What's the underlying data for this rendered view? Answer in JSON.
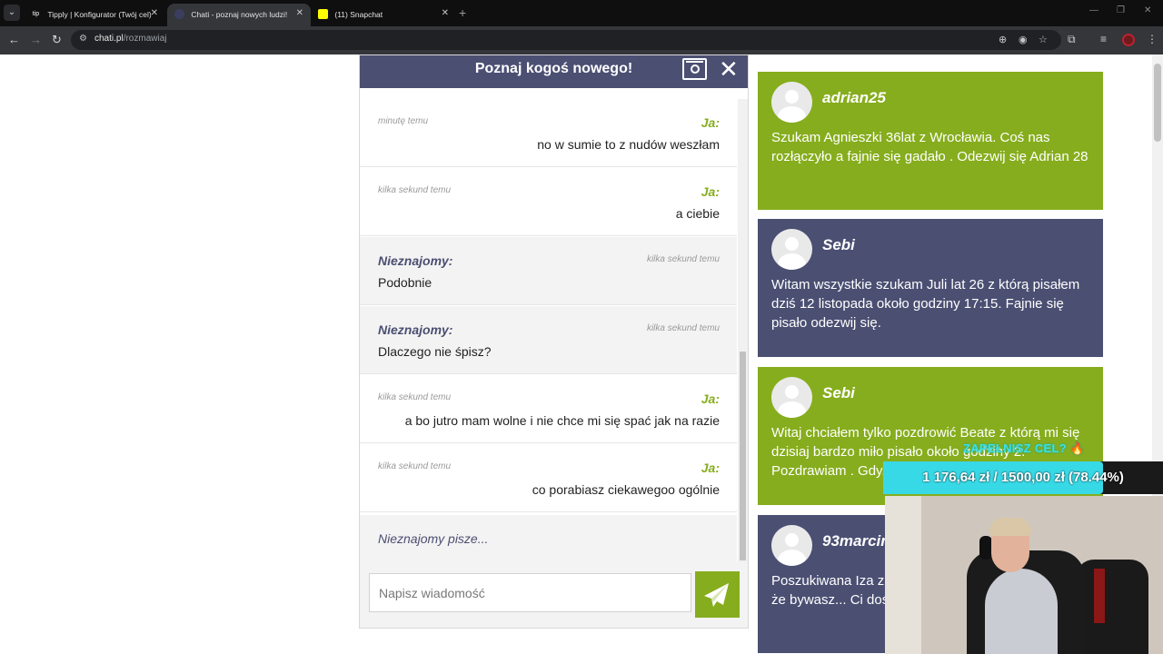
{
  "browser": {
    "tabs": [
      {
        "title": "Tipply | Konfigurator (Twój cel)",
        "favicon": "tipply-icon",
        "favicon_text": "tip",
        "active": false
      },
      {
        "title": "Chati - poznaj nowych ludzi!",
        "favicon": "chati-icon",
        "favicon_text": "",
        "active": true
      },
      {
        "title": "(11) Snapchat",
        "favicon": "snapchat-icon",
        "favicon_text": "",
        "active": false
      }
    ],
    "url_host": "chati.pl",
    "url_path": "/rozmawiaj"
  },
  "chat": {
    "title": "Poznaj kogoś nowego!",
    "messages": [
      {
        "sender": "me",
        "name": "Ja:",
        "time": "minutę temu",
        "text": "no w sumie to z nudów weszłam"
      },
      {
        "sender": "me",
        "name": "Ja:",
        "time": "kilka sekund temu",
        "text": "a ciebie"
      },
      {
        "sender": "them",
        "name": "Nieznajomy:",
        "time": "kilka sekund temu",
        "text": "Podobnie"
      },
      {
        "sender": "them",
        "name": "Nieznajomy:",
        "time": "kilka sekund temu",
        "text": "Dlaczego nie śpisz?"
      },
      {
        "sender": "me",
        "name": "Ja:",
        "time": "kilka sekund temu",
        "text": "a bo jutro mam wolne i nie chce mi się spać jak na razie"
      },
      {
        "sender": "me",
        "name": "Ja:",
        "time": "kilka sekund temu",
        "text": "co porabiasz ciekawegoo ogólnie"
      }
    ],
    "typing": "Nieznajomy pisze...",
    "input_placeholder": "Napisz wiadomość"
  },
  "ads": [
    {
      "name": "adrian25",
      "color": "green",
      "text": "Szukam Agnieszki 36lat z Wrocławia. Coś nas rozłączyło a fajnie się gadało . Odezwij się Adrian 28"
    },
    {
      "name": "Sebi",
      "color": "navy",
      "text": "Witam wszystkie szukam Juli lat 26 z którą pisałem dziś 12 listopada około godziny 17:15. Fajnie się pisało odezwij się."
    },
    {
      "name": "Sebi",
      "color": "green",
      "text": "Witaj chciałem tylko pozdrowić Beate z którą mi się dzisiaj bardzo miło pisało około godziny 2. Pozdrawiam . Gdy... zapraszam ."
    },
    {
      "name": "93marcin",
      "color": "navy",
      "text": "Poszukiwana Iza z... Rozmawialiśmy po... Mówiłaś że bywasz... Ci dość śmiałe pyta..."
    }
  ],
  "overlay": {
    "goal_label": "ZAPEŁNISZ CEL? 🔥",
    "goal_text": "1 176,64 zł / 1500,00 zł (78.44%)",
    "goal_fraction": 0.7844
  },
  "colors": {
    "header": "#4b4f72",
    "accent_green": "#86ad1d",
    "goal_cyan": "#38d9e6"
  }
}
